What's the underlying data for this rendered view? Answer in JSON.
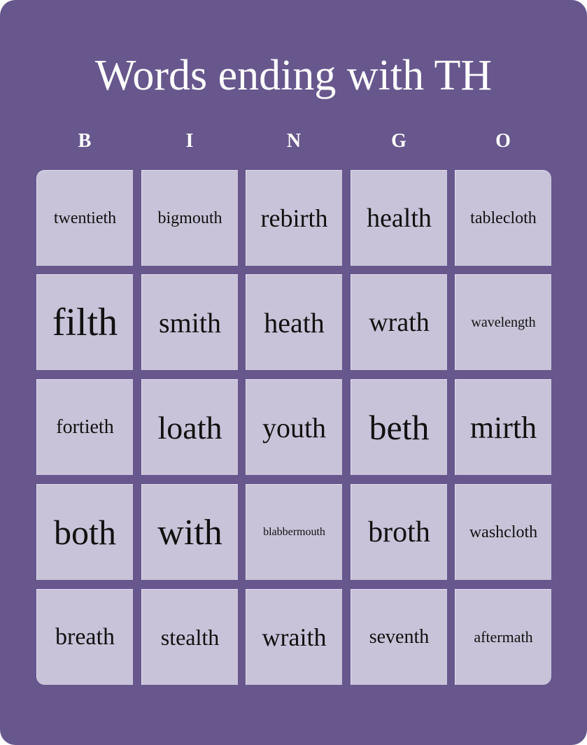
{
  "title": "Words ending with TH",
  "header_letters": [
    "B",
    "I",
    "N",
    "G",
    "O"
  ],
  "colors": {
    "background": "#67578d",
    "cell": "#c8c3d8",
    "title_text": "#ffffff",
    "cell_text": "#111111"
  },
  "grid": [
    [
      "twentieth",
      "bigmouth",
      "rebirth",
      "health",
      "tablecloth"
    ],
    [
      "filth",
      "smith",
      "heath",
      "wrath",
      "wavelength"
    ],
    [
      "fortieth",
      "loath",
      "youth",
      "beth",
      "mirth"
    ],
    [
      "both",
      "with",
      "blabbermouth",
      "broth",
      "washcloth"
    ],
    [
      "breath",
      "stealth",
      "wraith",
      "seventh",
      "aftermath"
    ]
  ]
}
